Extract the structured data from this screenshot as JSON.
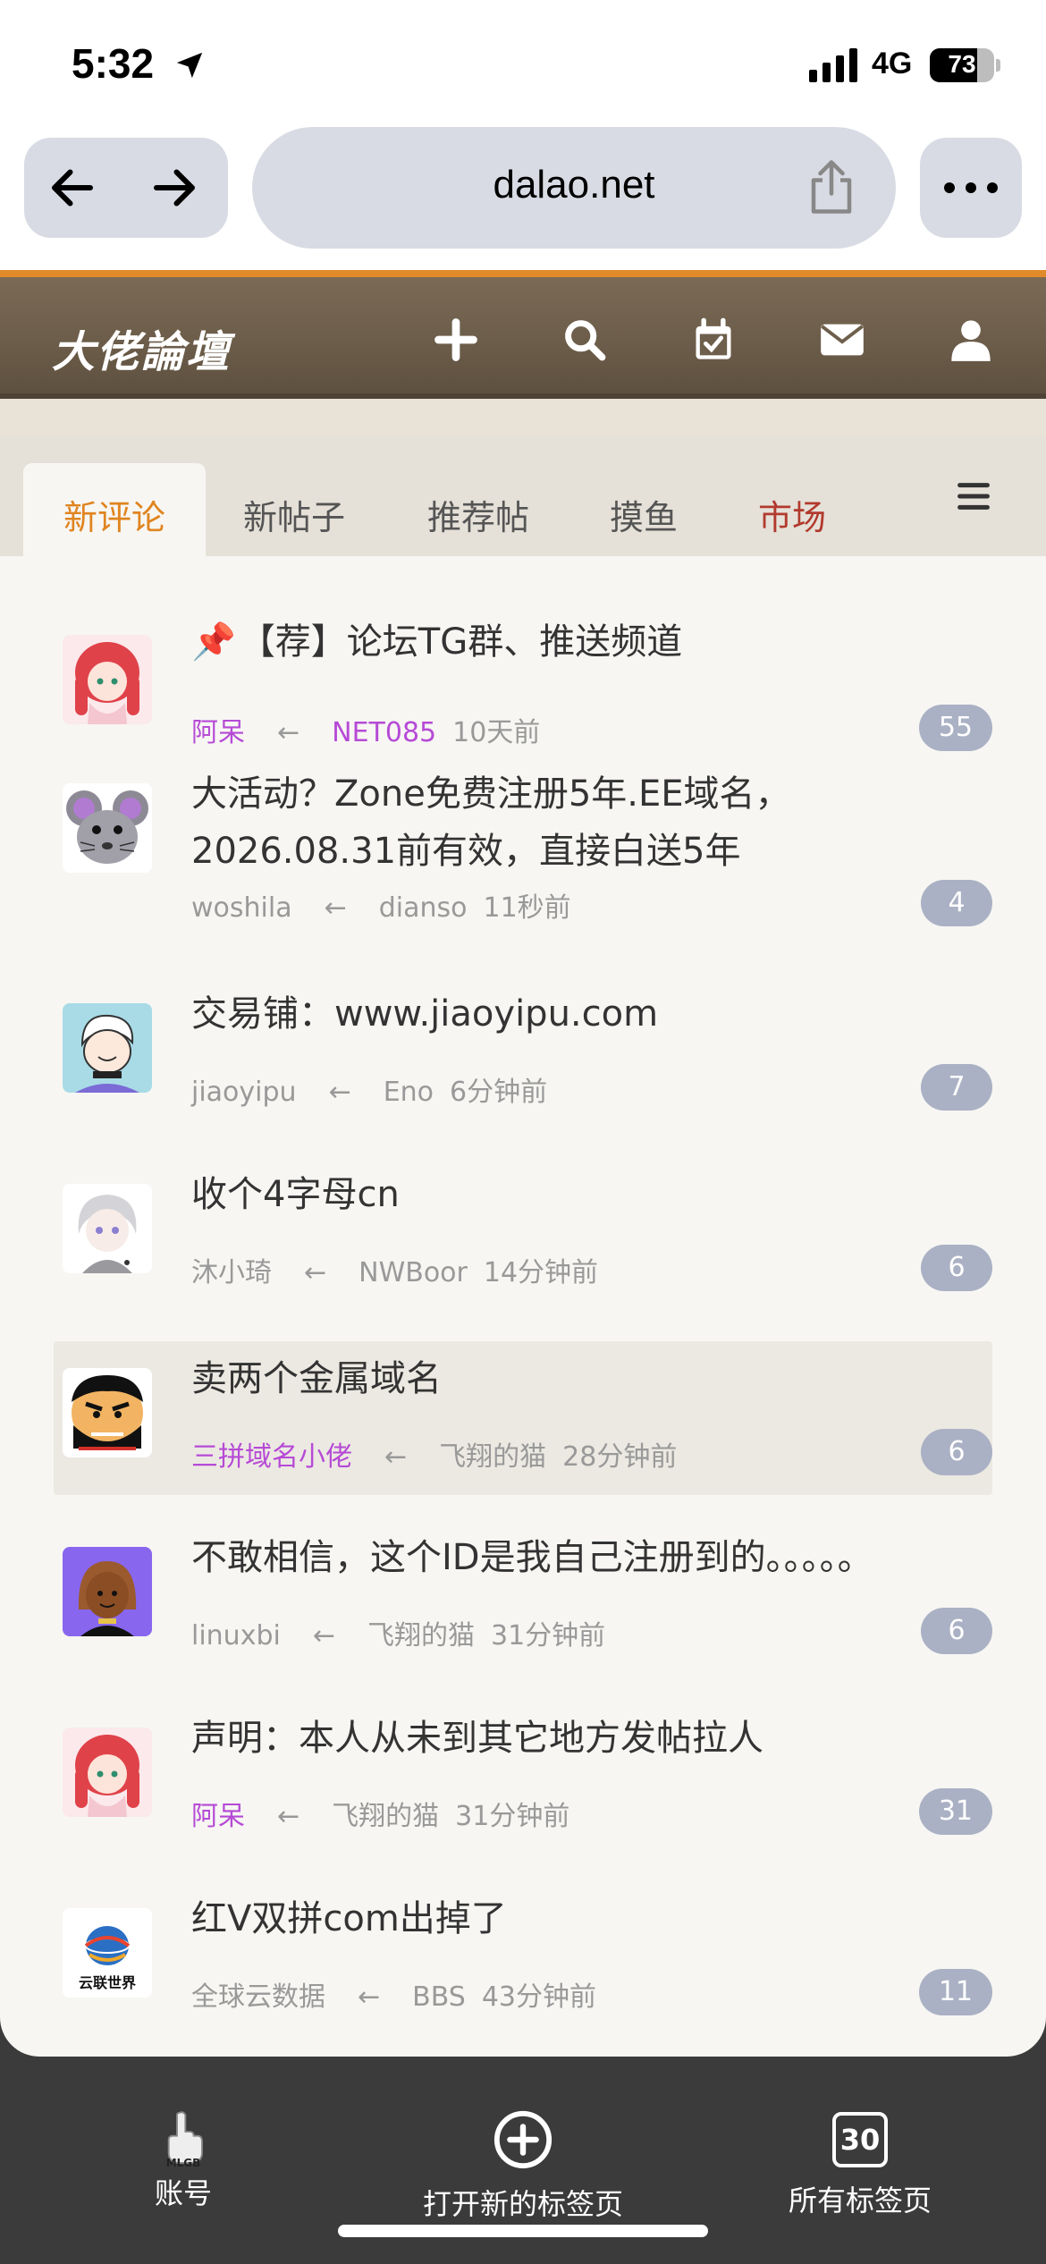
{
  "status": {
    "time": "5:32",
    "network": "4G",
    "battery": "73",
    "battery_level": 0.73
  },
  "browser": {
    "url": "dalao.net"
  },
  "forum": {
    "logo": "大佬論壇",
    "tabs": [
      {
        "label": "新评论"
      },
      {
        "label": "新帖子"
      },
      {
        "label": "推荐帖"
      },
      {
        "label": "摸鱼"
      },
      {
        "label": "市场"
      }
    ]
  },
  "threads": [
    {
      "pin": "📌",
      "title": "【荐】论坛TG群、推送频道",
      "author": "阿呆",
      "arrow": "←",
      "last": "NET085",
      "time": "10天前",
      "count": "55"
    },
    {
      "title": "大活动？Zone免费注册5年.EE域名，2026.08.31前有效，直接白送5年",
      "author": "woshila",
      "arrow": "←",
      "last": "dianso",
      "time": "11秒前",
      "count": "4"
    },
    {
      "title": "交易铺：www.jiaoyipu.com",
      "author": "jiaoyipu",
      "arrow": "←",
      "last": "Eno",
      "time": "6分钟前",
      "count": "7"
    },
    {
      "title": "收个4字母cn",
      "author": "沐小琦",
      "arrow": "←",
      "last": "NWBoor",
      "time": "14分钟前",
      "count": "6"
    },
    {
      "title": "卖两个金属域名",
      "author": "三拼域名小佬",
      "arrow": "←",
      "last": "飞翔的猫",
      "time": "28分钟前",
      "count": "6"
    },
    {
      "title": "不敢相信，这个ID是我自己注册到的。。。。。",
      "author": "linuxbi",
      "arrow": "←",
      "last": "飞翔的猫",
      "time": "31分钟前",
      "count": "6"
    },
    {
      "title": "声明：本人从未到其它地方发帖拉人",
      "author": "阿呆",
      "arrow": "←",
      "last": "飞翔的猫",
      "time": "31分钟前",
      "count": "31"
    },
    {
      "title": "红V双拼com出掉了",
      "author": "全球云数据",
      "arrow": "←",
      "last": "BBS",
      "time": "43分钟前",
      "count": "11",
      "avatar_text": "云联世界"
    }
  ],
  "bottom_bar": {
    "account_label": "账号",
    "account_badge": "MLGB",
    "new_tab_label": "打开新的标签页",
    "all_tabs_label": "所有标签页",
    "tab_count": "30"
  },
  "colors": {
    "active_tab": "#e0841f",
    "market_tab": "#b23a2e",
    "purple_user": "#b64ad6",
    "count_badge": "#aab1c4"
  }
}
